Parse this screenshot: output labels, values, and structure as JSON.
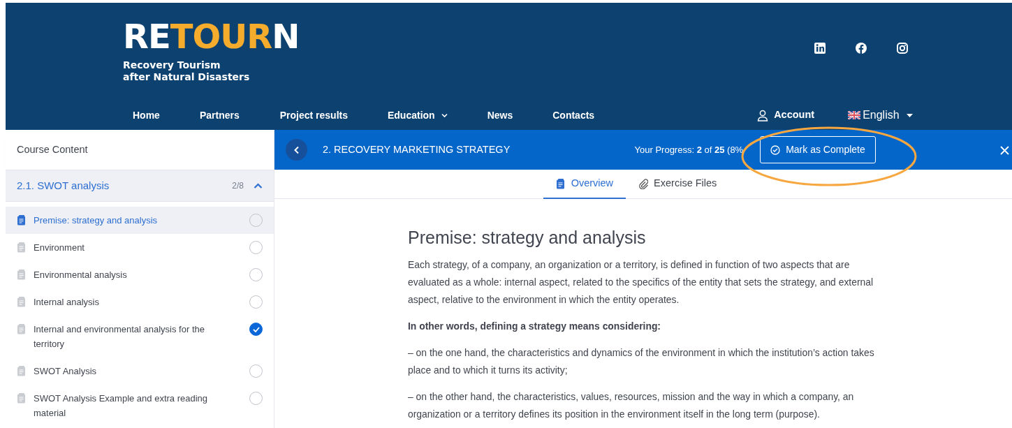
{
  "header": {
    "logo": {
      "parts": [
        {
          "text": "RE",
          "accent": false
        },
        {
          "text": "TOUR",
          "accent": true
        },
        {
          "text": "N",
          "accent": false
        }
      ]
    },
    "tagline": [
      "Recovery Tourism",
      "after Natural Disasters"
    ],
    "social": [
      {
        "kind": "linkedin"
      },
      {
        "kind": "facebook"
      },
      {
        "kind": "instagram"
      }
    ],
    "nav": [
      {
        "label": "Home",
        "dropdown": false
      },
      {
        "label": "Partners",
        "dropdown": false
      },
      {
        "label": "Project results",
        "dropdown": false
      },
      {
        "label": "Education",
        "dropdown": true
      },
      {
        "label": "News",
        "dropdown": false
      },
      {
        "label": "Contacts",
        "dropdown": false
      }
    ],
    "account": "Account",
    "language": "English"
  },
  "sidebar": {
    "title": "Course Content",
    "section": {
      "title": "2.1. SWOT analysis",
      "count": "2/8",
      "expanded": true
    },
    "lessons": [
      {
        "title": "Premise: strategy and analysis",
        "selected": true,
        "checked": false
      },
      {
        "title": "Environment",
        "selected": false,
        "checked": false
      },
      {
        "title": "Environmental analysis",
        "selected": false,
        "checked": false
      },
      {
        "title": "Internal analysis",
        "selected": false,
        "checked": false
      },
      {
        "title": "Internal and environmental analysis for the territory",
        "selected": false,
        "checked": true
      },
      {
        "title": "SWOT Analysis",
        "selected": false,
        "checked": false
      },
      {
        "title": "SWOT Analysis Example and extra reading material",
        "selected": false,
        "checked": false
      }
    ]
  },
  "topbar": {
    "course_title": "2. RECOVERY MARKETING STRATEGY",
    "progress": "Your Progress: **2** of **25** (8%",
    "mark_button": "Mark as Complete",
    "annotation": {
      "kind": "ellipse"
    }
  },
  "tabs": [
    {
      "label": "Overview",
      "kind": "document",
      "selected": true
    },
    {
      "label": "Exercise Files",
      "kind": "attachment",
      "selected": false
    }
  ],
  "lesson": {
    "title": "Premise: strategy and analysis",
    "paragraphs": [
      {
        "kind": "text",
        "text": "Each strategy, of a company, an organization or a territory, is defined in function of two aspects that are evaluated as a whole: internal aspect, related to the specifics of the entity that sets the strategy, and external aspect, relative to the environment in which the entity operates."
      },
      {
        "kind": "lead",
        "text": "In other words, defining a strategy means considering:"
      },
      {
        "kind": "text",
        "text": "–   on the one hand, the characteristics and dynamics of the environment in which the institution’s action takes place and to which it turns its activity;"
      },
      {
        "kind": "text",
        "text": "– on the other hand, the characteristics, values, resources, mission and the way in which a company, an organization or a territory defines its position in the environment itself in the long term (purpose)."
      }
    ]
  }
}
